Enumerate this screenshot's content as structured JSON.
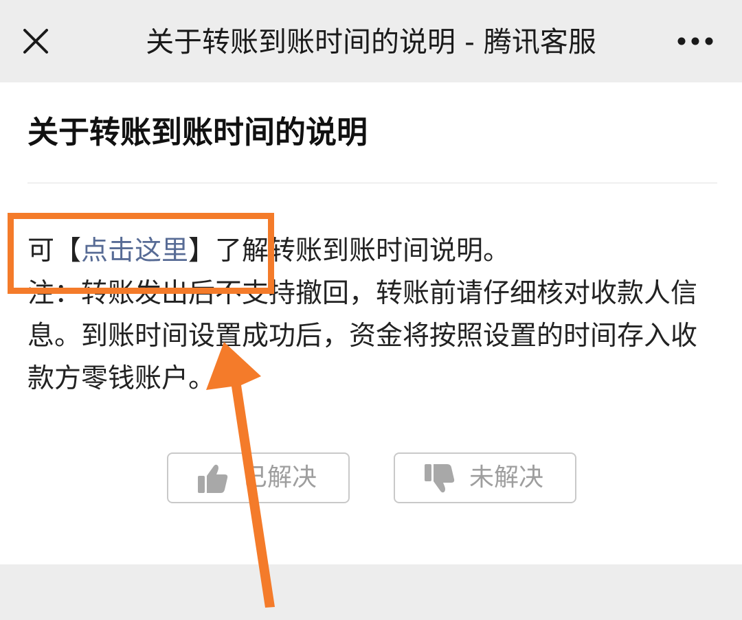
{
  "topbar": {
    "title": "关于转账到账时间的说明 - 腾讯客服",
    "close_icon": "close-icon",
    "more_icon": "more-dots-icon"
  },
  "article": {
    "title": "关于转账到账时间的说明",
    "line1_prefix": "可【",
    "link_text": "点击这里",
    "line1_suffix": "】了解转账到账时间说明。",
    "note": "注：转账发出后不支持撤回，转账前请仔细核对收款人信息。到账时间设置成功后，资金将按照设置的时间存入收款方零钱账户。"
  },
  "feedback": {
    "solved_label": "已解决",
    "unsolved_label": "未解决",
    "solved_icon": "thumbs-up-icon",
    "unsolved_icon": "thumbs-down-icon"
  },
  "colors": {
    "topbar_bg": "#ededed",
    "link": "#576b95",
    "annotation": "#f47b2a",
    "button_text": "#9e9e9e"
  }
}
